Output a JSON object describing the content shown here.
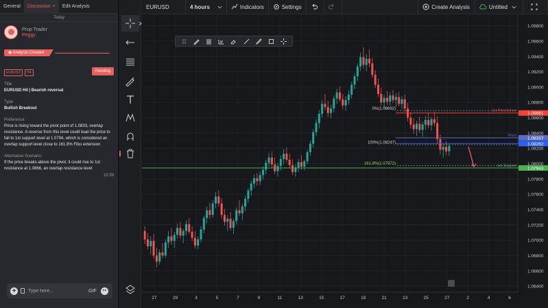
{
  "tabs": [
    {
      "label": "General"
    },
    {
      "label": "Discussion",
      "close": "×"
    },
    {
      "label": "Edit Analysis"
    }
  ],
  "today": "Today",
  "user": {
    "role": "Prop Trader",
    "name": "Peggy"
  },
  "analysis_created": "Analysis Created",
  "tags": [
    "EURUSD",
    "H4"
  ],
  "status": "Pending",
  "fields": {
    "title_label": "Title",
    "title_value": "EURUSD H4 | Bearish reversal",
    "type_label": "Type",
    "type_value": "Bullish Breakout",
    "preference_label": "Preference:",
    "preference_value": "Price is rising toward the pivot point of 1.0833, overlap resistance. A reverse from this level could lead the price to fall to 1st support level at 1.0794, which is considered an overlap support level close to 161.8% Fibo extension",
    "alternative_label": "Alternative Scenario:",
    "alternative_value": "If the price breaks above the pivot, it could rise to 1st resistance at 1.0866, an overlap resistance level"
  },
  "time": "10:39",
  "composer": {
    "placeholder": "Type here...",
    "gif": "GIF"
  },
  "icons": {
    "tools": [
      "crosshair-icon",
      "arrow-left-icon",
      "horizontal-lines-icon",
      "brush-icon",
      "text-icon",
      "pattern-icon",
      "magnet-icon",
      "trash-icon",
      "layers-icon"
    ],
    "float": [
      "drag-handle-icon",
      "pen-icon",
      "text-lines-icon",
      "ruler-icon",
      "eraser-icon",
      "line-icon",
      "brush-icon",
      "rectangle-icon",
      "crosshair-icon"
    ]
  },
  "topbar": {
    "symbol": "EURUSD",
    "interval": "4 hours",
    "indicators": "Indicators",
    "settings": "Settings",
    "create_analysis": "Create Analysis",
    "untitled": "Untitled"
  },
  "colors": {
    "accent": "#e8615a",
    "up": "#26a69a",
    "down": "#ef5350",
    "resistance": "#f44336",
    "pivot": "#5c6bc0",
    "support": "#4caf50"
  },
  "chart_data": {
    "type": "candlestick",
    "symbol": "EURUSD",
    "interval": "4 hours",
    "y_ticks": [
      "1.09800",
      "1.09600",
      "1.09400",
      "1.09200",
      "1.09000",
      "1.08800",
      "1.08600",
      "1.08400",
      "1.08200",
      "1.08000",
      "1.07800",
      "1.07600",
      "1.07400",
      "1.07200",
      "1.07000",
      "1.06800",
      "1.06600",
      "1.06400"
    ],
    "ylim": [
      1.0632,
      1.0994
    ],
    "x_ticks": [
      "27",
      "29",
      "3",
      "5",
      "7",
      "9",
      "11",
      "13",
      "15",
      "17",
      "19",
      "21",
      "23",
      "25",
      "27",
      "2",
      "4",
      "6"
    ],
    "levels": [
      {
        "name": "1st Resistance",
        "value": 1.08661,
        "label": "1.08661",
        "color": "#f44336"
      },
      {
        "name": "Pivot",
        "value": 1.08337,
        "label": "1.08337",
        "color": "#5c6bc0"
      },
      {
        "name": "",
        "value": 1.08262,
        "label": "1.08262",
        "color": "#2962ff"
      },
      {
        "name": "1st Support",
        "value": 1.07943,
        "label": "1.07943",
        "color": "#4caf50"
      }
    ],
    "fib": [
      {
        "label": "0%(1.08692)",
        "value": 1.08692
      },
      {
        "label": "100%(1.08247)",
        "value": 1.08247
      },
      {
        "label": "161.8%(1.07972)",
        "value": 1.07972
      }
    ],
    "candles_ohlc": [
      [
        1.0712,
        1.0718,
        1.0695,
        1.0701
      ],
      [
        1.0701,
        1.0709,
        1.0688,
        1.0692
      ],
      [
        1.0692,
        1.0705,
        1.0682,
        1.0699
      ],
      [
        1.0699,
        1.0708,
        1.0676,
        1.068
      ],
      [
        1.068,
        1.069,
        1.0665,
        1.0672
      ],
      [
        1.0672,
        1.0688,
        1.0668,
        1.0684
      ],
      [
        1.0684,
        1.0696,
        1.0676,
        1.068
      ],
      [
        1.068,
        1.0701,
        1.0677,
        1.0697
      ],
      [
        1.0697,
        1.0712,
        1.069,
        1.0705
      ],
      [
        1.0705,
        1.0716,
        1.0694,
        1.0699
      ],
      [
        1.0699,
        1.0711,
        1.069,
        1.0707
      ],
      [
        1.0707,
        1.0722,
        1.0702,
        1.0716
      ],
      [
        1.0716,
        1.0724,
        1.0702,
        1.0706
      ],
      [
        1.0706,
        1.0715,
        1.0696,
        1.0712
      ],
      [
        1.0712,
        1.0726,
        1.0706,
        1.0721
      ],
      [
        1.0721,
        1.0729,
        1.0708,
        1.0711
      ],
      [
        1.0711,
        1.0718,
        1.0699,
        1.0703
      ],
      [
        1.0703,
        1.0712,
        1.0689,
        1.0693
      ],
      [
        1.0693,
        1.0705,
        1.0688,
        1.0701
      ],
      [
        1.0701,
        1.0718,
        1.0697,
        1.0714
      ],
      [
        1.0714,
        1.0732,
        1.0709,
        1.0729
      ],
      [
        1.0729,
        1.0744,
        1.0722,
        1.0739
      ],
      [
        1.0739,
        1.0749,
        1.0728,
        1.0733
      ],
      [
        1.0733,
        1.0752,
        1.0729,
        1.0748
      ],
      [
        1.0748,
        1.0763,
        1.0742,
        1.0757
      ],
      [
        1.0757,
        1.0765,
        1.0744,
        1.0748
      ],
      [
        1.0748,
        1.0755,
        1.0728,
        1.0733
      ],
      [
        1.0733,
        1.0741,
        1.0719,
        1.0724
      ],
      [
        1.0724,
        1.0733,
        1.0712,
        1.0728
      ],
      [
        1.0728,
        1.0737,
        1.0713,
        1.0716
      ],
      [
        1.0716,
        1.0728,
        1.0708,
        1.0725
      ],
      [
        1.0725,
        1.0743,
        1.072,
        1.0739
      ],
      [
        1.0739,
        1.0752,
        1.0731,
        1.0735
      ],
      [
        1.0735,
        1.0747,
        1.0726,
        1.0744
      ],
      [
        1.0744,
        1.0758,
        1.0738,
        1.0754
      ],
      [
        1.0754,
        1.0768,
        1.0749,
        1.0765
      ],
      [
        1.0765,
        1.0778,
        1.0758,
        1.0774
      ],
      [
        1.0774,
        1.0786,
        1.0768,
        1.0781
      ],
      [
        1.0781,
        1.0788,
        1.0771,
        1.0777
      ],
      [
        1.0777,
        1.079,
        1.0772,
        1.0785
      ],
      [
        1.0785,
        1.0797,
        1.0779,
        1.0792
      ],
      [
        1.0792,
        1.0805,
        1.0786,
        1.0801
      ],
      [
        1.0801,
        1.0814,
        1.0796,
        1.0808
      ],
      [
        1.0808,
        1.0816,
        1.0794,
        1.0799
      ],
      [
        1.0799,
        1.0808,
        1.0786,
        1.079
      ],
      [
        1.079,
        1.0801,
        1.0783,
        1.0797
      ],
      [
        1.0797,
        1.0811,
        1.0791,
        1.0806
      ],
      [
        1.0806,
        1.0819,
        1.0799,
        1.0813
      ],
      [
        1.0813,
        1.0821,
        1.0802,
        1.0805
      ],
      [
        1.0805,
        1.0813,
        1.0794,
        1.0798
      ],
      [
        1.0798,
        1.0806,
        1.0785,
        1.0789
      ],
      [
        1.0789,
        1.0799,
        1.0783,
        1.0795
      ],
      [
        1.0795,
        1.0806,
        1.0789,
        1.0802
      ],
      [
        1.0802,
        1.0811,
        1.0792,
        1.0796
      ],
      [
        1.0796,
        1.0805,
        1.0791,
        1.0803
      ],
      [
        1.0803,
        1.0818,
        1.0799,
        1.0815
      ],
      [
        1.0815,
        1.083,
        1.081,
        1.0826
      ],
      [
        1.0826,
        1.0845,
        1.0821,
        1.0841
      ],
      [
        1.0841,
        1.0858,
        1.0836,
        1.0853
      ],
      [
        1.0853,
        1.087,
        1.0846,
        1.0865
      ],
      [
        1.0865,
        1.0883,
        1.086,
        1.0878
      ],
      [
        1.0878,
        1.0891,
        1.087,
        1.0874
      ],
      [
        1.0874,
        1.0882,
        1.0861,
        1.0866
      ],
      [
        1.0866,
        1.0877,
        1.0859,
        1.0872
      ],
      [
        1.0872,
        1.0889,
        1.0867,
        1.0885
      ],
      [
        1.0885,
        1.0898,
        1.0878,
        1.0893
      ],
      [
        1.0893,
        1.0901,
        1.0881,
        1.0884
      ],
      [
        1.0884,
        1.0891,
        1.0871,
        1.0876
      ],
      [
        1.0876,
        1.0888,
        1.0869,
        1.0883
      ],
      [
        1.0883,
        1.0896,
        1.0877,
        1.089
      ],
      [
        1.089,
        1.0907,
        1.0885,
        1.0903
      ],
      [
        1.0903,
        1.0918,
        1.0897,
        1.0914
      ],
      [
        1.0914,
        1.0931,
        1.0908,
        1.0927
      ],
      [
        1.0927,
        1.0945,
        1.0921,
        1.0939
      ],
      [
        1.0939,
        1.0952,
        1.0924,
        1.0929
      ],
      [
        1.0929,
        1.0943,
        1.0921,
        1.0937
      ],
      [
        1.0937,
        1.0949,
        1.0926,
        1.0931
      ],
      [
        1.0931,
        1.0938,
        1.0912,
        1.0916
      ],
      [
        1.0916,
        1.0922,
        1.0899,
        1.0903
      ],
      [
        1.0903,
        1.0911,
        1.0887,
        1.0891
      ],
      [
        1.0891,
        1.0899,
        1.0876,
        1.088
      ],
      [
        1.088,
        1.089,
        1.0873,
        1.0886
      ],
      [
        1.0886,
        1.0895,
        1.0877,
        1.0881
      ],
      [
        1.0881,
        1.0893,
        1.0876,
        1.0889
      ],
      [
        1.0889,
        1.0896,
        1.0879,
        1.0883
      ],
      [
        1.0883,
        1.0892,
        1.0874,
        1.0887
      ],
      [
        1.0887,
        1.0894,
        1.0875,
        1.0878
      ],
      [
        1.0878,
        1.0888,
        1.0871,
        1.0884
      ],
      [
        1.0884,
        1.089,
        1.0868,
        1.0872
      ],
      [
        1.0872,
        1.0879,
        1.0855,
        1.086
      ],
      [
        1.086,
        1.0867,
        1.0846,
        1.0851
      ],
      [
        1.0851,
        1.0859,
        1.0839,
        1.0845
      ],
      [
        1.0845,
        1.0856,
        1.0836,
        1.0852
      ],
      [
        1.0852,
        1.0861,
        1.084,
        1.0844
      ],
      [
        1.0844,
        1.0855,
        1.0835,
        1.0851
      ],
      [
        1.0851,
        1.0862,
        1.0844,
        1.0857
      ],
      [
        1.0857,
        1.0866,
        1.0846,
        1.085
      ],
      [
        1.085,
        1.0861,
        1.0843,
        1.0858
      ],
      [
        1.0858,
        1.0868,
        1.0849,
        1.0853
      ],
      [
        1.0853,
        1.0862,
        1.0826,
        1.0832
      ],
      [
        1.0832,
        1.0838,
        1.0812,
        1.0818
      ],
      [
        1.0818,
        1.0826,
        1.0808,
        1.0822
      ],
      [
        1.0822,
        1.0829,
        1.0811,
        1.0816
      ],
      [
        1.0816,
        1.0826,
        1.081,
        1.0823
      ]
    ]
  }
}
